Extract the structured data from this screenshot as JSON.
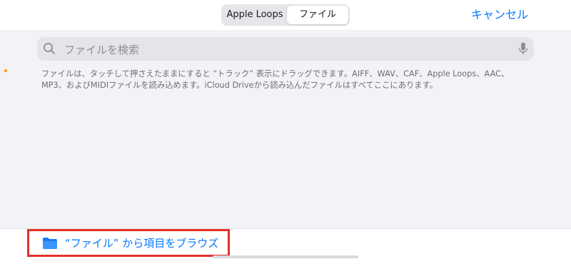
{
  "header": {
    "segments": [
      "Apple Loops",
      "ファイル"
    ],
    "active_segment": "ファイル",
    "cancel_label": "キャンセル"
  },
  "search": {
    "placeholder": "ファイルを検索",
    "value": ""
  },
  "info": {
    "text": "ファイルは、タッチして押さえたままにすると “トラック” 表示にドラッグできます。AIFF、WAV、CAF、Apple Loops、AAC、\nMP3、およびMIDIファイルを読み込めます。iCloud Driveから読み込んだファイルはすべてここにあります。"
  },
  "bottom": {
    "browse_label": "“ファイル” から項目をブラウズ",
    "icon": "folder-icon"
  },
  "colors": {
    "accent": "#007aff",
    "highlight_border": "#e5302a",
    "background": "#f2f2f7",
    "marker": "#ff9500"
  }
}
